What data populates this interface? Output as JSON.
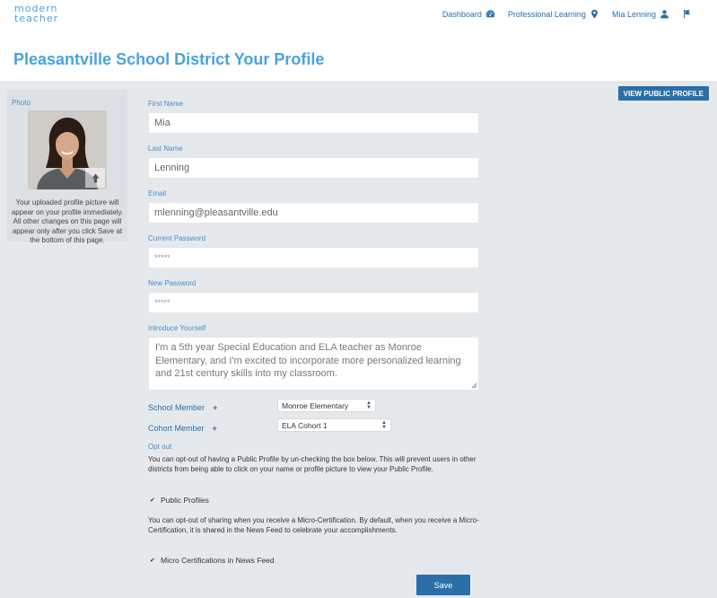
{
  "logo": {
    "line1": "modern",
    "line2": "teacher"
  },
  "nav": {
    "dashboard": "Dashboard",
    "professional_learning": "Professional Learning",
    "user_name": "Mia Lenning"
  },
  "page_title": "Pleasantville School District Your Profile",
  "view_public_profile": "VIEW PUBLIC PROFILE",
  "photo": {
    "label": "Photo",
    "note": "Your uploaded profile picture will appear on your profile immediately. All other changes on this page will appear only after you click Save at the bottom of this page."
  },
  "form": {
    "first_name": {
      "label": "First Name",
      "value": "Mia"
    },
    "last_name": {
      "label": "Last Name",
      "value": "Lenning"
    },
    "email": {
      "label": "Email",
      "value": "mlenning@pleasantville.edu"
    },
    "current_password": {
      "label": "Current Password",
      "value": "*****"
    },
    "new_password": {
      "label": "New Password",
      "value": "*****"
    },
    "introduce": {
      "label": "Introduce Yourself",
      "value": "I'm a 5th year Special Education and ELA teacher as Monroe Elementary, and I'm excited to incorporate more personalized learning and 21st century skills into my classroom."
    },
    "school_member": {
      "label": "School Member",
      "plus": "+",
      "selected": "Monroe Elementary"
    },
    "cohort_member": {
      "label": "Cohort Member",
      "plus": "+",
      "selected": "ELA Cohort 1"
    }
  },
  "opt_out": {
    "title": "Opt out",
    "public_profile_text": "You can opt-out of having a Public Profile by un-checking the box below. This will prevent users in other districts from being able to click on your name or profile picture to view your Public Profile.",
    "public_profiles_label": "Public Profiles",
    "public_profiles_checked": true,
    "micro_cert_text": "You can opt-out of sharing when you receive a Micro-Certification. By default, when you receive a Micro-Certification, it is shared in the News Feed to celebrate your accomplishments.",
    "micro_cert_label": "Micro Certifications in News Feed",
    "micro_cert_checked": true
  },
  "save_label": "Save",
  "colors": {
    "brand": "#4aa3df",
    "primary": "#2a6fa8",
    "background": "#e6e9ec"
  }
}
